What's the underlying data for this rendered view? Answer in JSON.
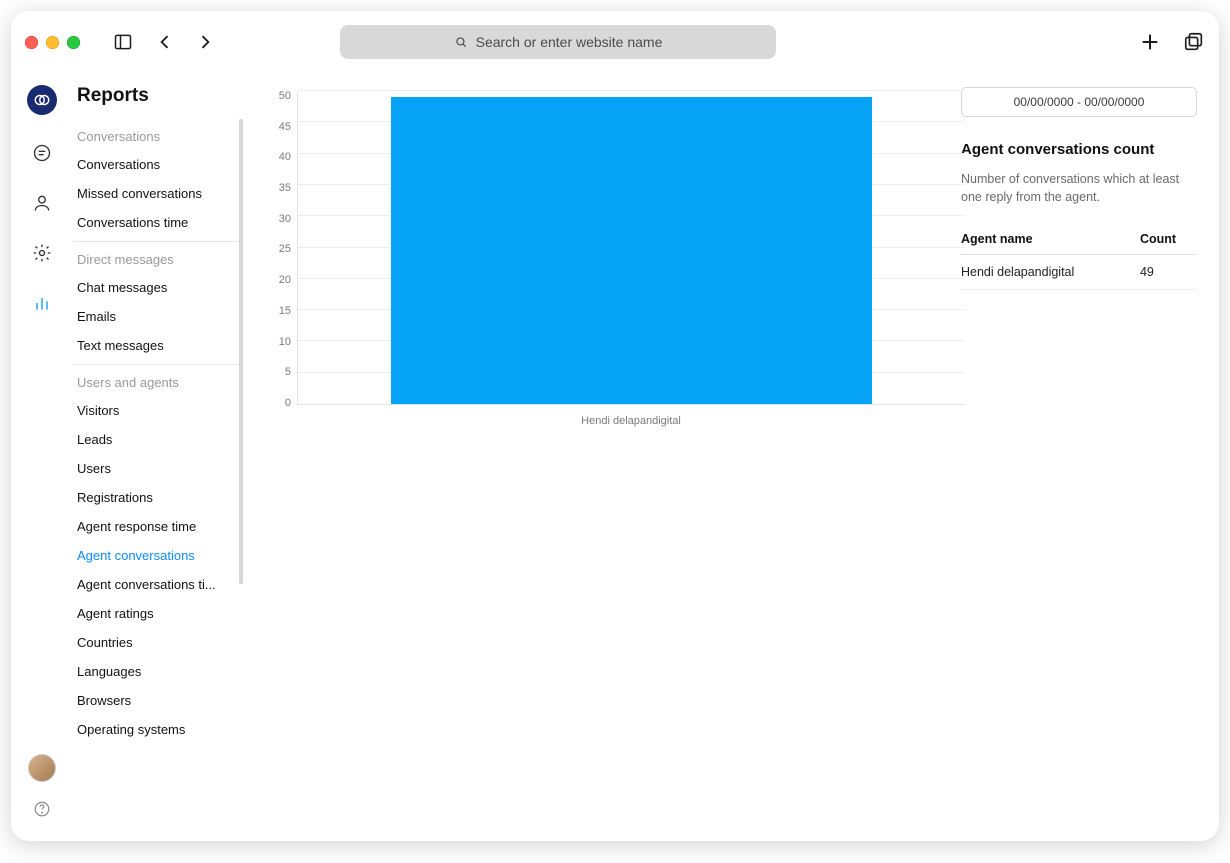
{
  "titlebar": {
    "search_placeholder": "Search or enter website name"
  },
  "sidebar": {
    "title": "Reports",
    "sections": [
      {
        "heading": "Conversations",
        "items": [
          "Conversations",
          "Missed conversations",
          "Conversations time"
        ]
      },
      {
        "heading": "Direct messages",
        "items": [
          "Chat messages",
          "Emails",
          "Text messages"
        ]
      },
      {
        "heading": "Users and agents",
        "items": [
          "Visitors",
          "Leads",
          "Users",
          "Registrations",
          "Agent response time",
          "Agent conversations",
          "Agent conversations ti...",
          "Agent ratings",
          "Countries",
          "Languages",
          "Browsers",
          "Operating systems"
        ]
      }
    ],
    "active_item": "Agent conversations"
  },
  "date_range": "00/00/0000 - 00/00/0000",
  "panel": {
    "title": "Agent conversations count",
    "desc": "Number of conversations which at least one reply from the agent.",
    "columns": [
      "Agent name",
      "Count"
    ],
    "rows": [
      {
        "agent": "Hendi delapandigital",
        "count": 49
      }
    ]
  },
  "chart_data": {
    "type": "bar",
    "categories": [
      "Hendi delapandigital"
    ],
    "values": [
      49
    ],
    "ylim": [
      0,
      50
    ],
    "yticks": [
      50,
      45,
      40,
      35,
      30,
      25,
      20,
      15,
      10,
      5,
      0
    ]
  }
}
